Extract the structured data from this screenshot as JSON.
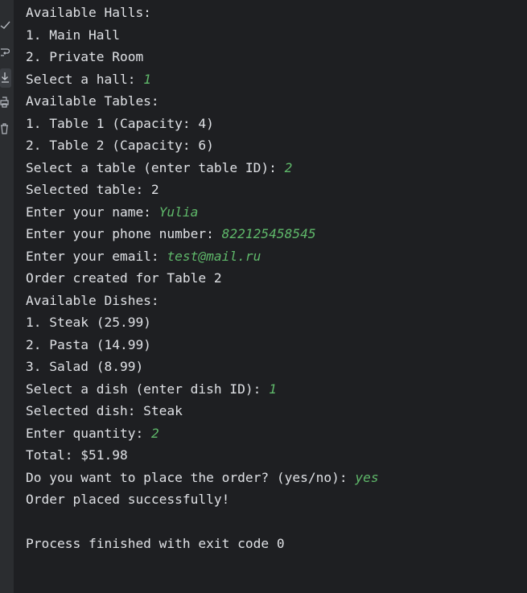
{
  "gutter": {
    "icons": [
      "soft-wrap-icon",
      "scroll-to-end-icon",
      "print-icon",
      "trash-icon"
    ]
  },
  "console": {
    "lines": [
      {
        "text": "Available Halls:",
        "input": ""
      },
      {
        "text": "1. Main Hall",
        "input": ""
      },
      {
        "text": "2. Private Room",
        "input": ""
      },
      {
        "text": "Select a hall: ",
        "input": "1"
      },
      {
        "text": "Available Tables:",
        "input": ""
      },
      {
        "text": "1. Table 1 (Capacity: 4)",
        "input": ""
      },
      {
        "text": "2. Table 2 (Capacity: 6)",
        "input": ""
      },
      {
        "text": "Select a table (enter table ID): ",
        "input": "2"
      },
      {
        "text": "Selected table: 2",
        "input": ""
      },
      {
        "text": "Enter your name: ",
        "input": "Yulia"
      },
      {
        "text": "Enter your phone number: ",
        "input": "822125458545"
      },
      {
        "text": "Enter your email: ",
        "input": "test@mail.ru"
      },
      {
        "text": "Order created for Table 2",
        "input": ""
      },
      {
        "text": "Available Dishes:",
        "input": ""
      },
      {
        "text": "1. Steak (25.99)",
        "input": ""
      },
      {
        "text": "2. Pasta (14.99)",
        "input": ""
      },
      {
        "text": "3. Salad (8.99)",
        "input": ""
      },
      {
        "text": "Select a dish (enter dish ID): ",
        "input": "1"
      },
      {
        "text": "Selected dish: Steak",
        "input": ""
      },
      {
        "text": "Enter quantity: ",
        "input": "2"
      },
      {
        "text": "Total: $51.98",
        "input": ""
      },
      {
        "text": "Do you want to place the order? (yes/no): ",
        "input": "yes"
      },
      {
        "text": "Order placed successfully!",
        "input": ""
      },
      {
        "text": "",
        "input": ""
      },
      {
        "text": "Process finished with exit code 0",
        "input": ""
      }
    ]
  },
  "colors": {
    "background": "#1e1f22",
    "gutter": "#2b2d30",
    "text": "#dfe1e5",
    "user_input": "#5fb86a"
  }
}
